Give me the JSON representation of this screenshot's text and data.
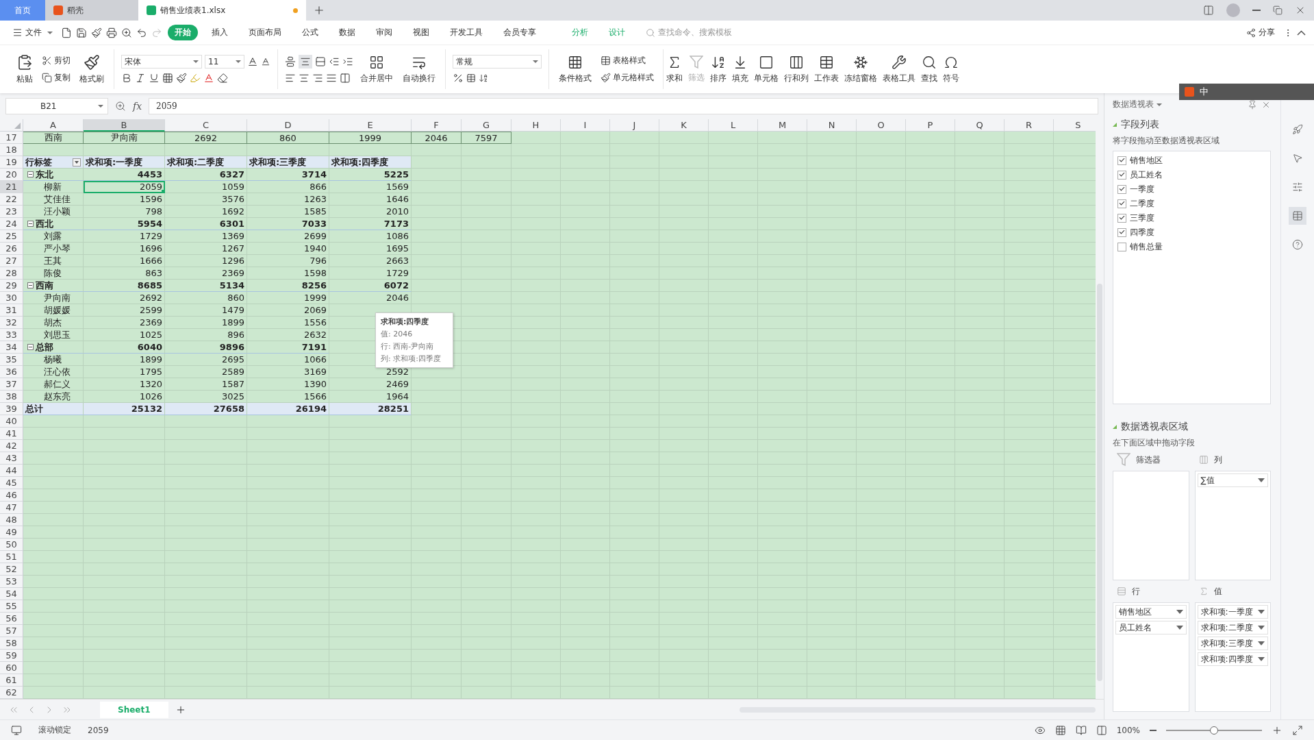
{
  "tabs": [
    {
      "label": "首页",
      "selected": false,
      "kind": "home"
    },
    {
      "label": "稻壳",
      "selected": false,
      "kind": "docer"
    },
    {
      "label": "销售业绩表1.xlsx",
      "selected": true,
      "kind": "sheet",
      "modified": true
    }
  ],
  "menu": {
    "file": "文件",
    "items": [
      {
        "label": "开始",
        "selected": true,
        "kind": "main"
      },
      {
        "label": "插入",
        "selected": false,
        "kind": "main"
      },
      {
        "label": "页面布局",
        "selected": false,
        "kind": "main"
      },
      {
        "label": "公式",
        "selected": false,
        "kind": "main"
      },
      {
        "label": "数据",
        "selected": false,
        "kind": "main"
      },
      {
        "label": "审阅",
        "selected": false,
        "kind": "main"
      },
      {
        "label": "视图",
        "selected": false,
        "kind": "main"
      },
      {
        "label": "开发工具",
        "selected": false,
        "kind": "main"
      },
      {
        "label": "会员专享",
        "selected": false,
        "kind": "main"
      },
      {
        "label": "分析",
        "selected": false,
        "kind": "context"
      },
      {
        "label": "设计",
        "selected": false,
        "kind": "context"
      }
    ],
    "search_placeholder": "查找命令、搜索模板",
    "share": "分享"
  },
  "ribbon": {
    "paste": "粘贴",
    "cut": "剪切",
    "copy": "复制",
    "format_painter": "格式刷",
    "font": "宋体",
    "font_size": "11",
    "merge": "合并居中",
    "wrap": "自动换行",
    "number_format": "常规",
    "conditional": "条件格式",
    "table_style": "表格样式",
    "cell_style": "单元格样式",
    "tools": [
      {
        "label": "求和",
        "disabled": false
      },
      {
        "label": "筛选",
        "disabled": true
      },
      {
        "label": "排序",
        "disabled": false
      },
      {
        "label": "填充",
        "disabled": false
      },
      {
        "label": "单元格",
        "disabled": false
      },
      {
        "label": "行和列",
        "disabled": false
      },
      {
        "label": "工作表",
        "disabled": false
      },
      {
        "label": "冻结窗格",
        "disabled": false
      },
      {
        "label": "表格工具",
        "disabled": false
      },
      {
        "label": "查找",
        "disabled": false
      },
      {
        "label": "符号",
        "disabled": false
      }
    ]
  },
  "ime": {
    "label": "中"
  },
  "name_box": "B21",
  "function_label": "fx",
  "formula": "2059",
  "columns": [
    {
      "label": "A",
      "selected": false
    },
    {
      "label": "B",
      "selected": true
    },
    {
      "label": "C",
      "selected": false
    },
    {
      "label": "D",
      "selected": false
    },
    {
      "label": "E",
      "selected": false
    },
    {
      "label": "F",
      "selected": false
    },
    {
      "label": "G",
      "selected": false
    },
    {
      "label": "H",
      "selected": false
    },
    {
      "label": "I",
      "selected": false
    },
    {
      "label": "J",
      "selected": false
    },
    {
      "label": "K",
      "selected": false
    },
    {
      "label": "L",
      "selected": false
    },
    {
      "label": "M",
      "selected": false
    },
    {
      "label": "N",
      "selected": false
    },
    {
      "label": "O",
      "selected": false
    },
    {
      "label": "P",
      "selected": false
    },
    {
      "label": "Q",
      "selected": false
    },
    {
      "label": "R",
      "selected": false
    },
    {
      "label": "S",
      "selected": false
    }
  ],
  "rows": [
    {
      "number": "17",
      "kind": "plain",
      "selected": false,
      "cells": [
        "西南",
        "尹向南",
        "2692",
        "860",
        "1999",
        "2046",
        "7597"
      ]
    },
    {
      "number": "18",
      "kind": "empty",
      "selected": false
    },
    {
      "number": "19",
      "kind": "pivot-header",
      "selected": false,
      "cells": [
        "行标签",
        "求和项:一季度",
        "求和项:二季度",
        "求和项:三季度",
        "求和项:四季度"
      ]
    },
    {
      "number": "20",
      "kind": "group",
      "expanded": true,
      "selected": false,
      "cells": [
        "东北",
        "4453",
        "6327",
        "3714",
        "5225"
      ]
    },
    {
      "number": "21",
      "kind": "item",
      "selected": true,
      "cells": [
        "柳新",
        "2059",
        "1059",
        "866",
        "1569"
      ]
    },
    {
      "number": "22",
      "kind": "item",
      "selected": false,
      "cells": [
        "艾佳佳",
        "1596",
        "3576",
        "1263",
        "1646"
      ]
    },
    {
      "number": "23",
      "kind": "item",
      "selected": false,
      "cells": [
        "汪小颖",
        "798",
        "1692",
        "1585",
        "2010"
      ]
    },
    {
      "number": "24",
      "kind": "group",
      "expanded": true,
      "selected": false,
      "cells": [
        "西北",
        "5954",
        "6301",
        "7033",
        "7173"
      ]
    },
    {
      "number": "25",
      "kind": "item",
      "selected": false,
      "cells": [
        "刘露",
        "1729",
        "1369",
        "2699",
        "1086"
      ]
    },
    {
      "number": "26",
      "kind": "item",
      "selected": false,
      "cells": [
        "严小琴",
        "1696",
        "1267",
        "1940",
        "1695"
      ]
    },
    {
      "number": "27",
      "kind": "item",
      "selected": false,
      "cells": [
        "王其",
        "1666",
        "1296",
        "796",
        "2663"
      ]
    },
    {
      "number": "28",
      "kind": "item",
      "selected": false,
      "cells": [
        "陈俊",
        "863",
        "2369",
        "1598",
        "1729"
      ]
    },
    {
      "number": "29",
      "kind": "group",
      "expanded": true,
      "selected": false,
      "cells": [
        "西南",
        "8685",
        "5134",
        "8256",
        "6072"
      ]
    },
    {
      "number": "30",
      "kind": "item",
      "selected": false,
      "cells": [
        "尹向南",
        "2692",
        "860",
        "1999",
        "2046"
      ]
    },
    {
      "number": "31",
      "kind": "item",
      "selected": false,
      "cells": [
        "胡媛媛",
        "2599",
        "1479",
        "2069"
      ]
    },
    {
      "number": "32",
      "kind": "item",
      "selected": false,
      "cells": [
        "胡杰",
        "2369",
        "1899",
        "1556"
      ]
    },
    {
      "number": "33",
      "kind": "item",
      "selected": false,
      "cells": [
        "刘思玉",
        "1025",
        "896",
        "2632"
      ]
    },
    {
      "number": "34",
      "kind": "group",
      "expanded": true,
      "selected": false,
      "cells": [
        "总部",
        "6040",
        "9896",
        "7191"
      ]
    },
    {
      "number": "35",
      "kind": "item",
      "selected": false,
      "cells": [
        "杨曦",
        "1899",
        "2695",
        "1066"
      ]
    },
    {
      "number": "36",
      "kind": "item",
      "selected": false,
      "cells": [
        "汪心依",
        "1795",
        "2589",
        "3169",
        "2592"
      ]
    },
    {
      "number": "37",
      "kind": "item",
      "selected": false,
      "cells": [
        "郝仁义",
        "1320",
        "1587",
        "1390",
        "2469"
      ]
    },
    {
      "number": "38",
      "kind": "item",
      "selected": false,
      "cells": [
        "赵东亮",
        "1026",
        "3025",
        "1566",
        "1964"
      ]
    },
    {
      "number": "39",
      "kind": "total",
      "selected": false,
      "cells": [
        "总计",
        "25132",
        "27658",
        "26194",
        "28251"
      ]
    },
    {
      "number": "40",
      "kind": "empty",
      "selected": false
    },
    {
      "number": "41",
      "kind": "empty",
      "selected": false
    },
    {
      "number": "42",
      "kind": "empty",
      "selected": false
    },
    {
      "number": "43",
      "kind": "empty",
      "selected": false
    },
    {
      "number": "44",
      "kind": "empty",
      "selected": false
    },
    {
      "number": "45",
      "kind": "empty",
      "selected": false
    },
    {
      "number": "46",
      "kind": "empty",
      "selected": false
    },
    {
      "number": "47",
      "kind": "empty",
      "selected": false
    },
    {
      "number": "48",
      "kind": "empty",
      "selected": false
    },
    {
      "number": "49",
      "kind": "empty",
      "selected": false
    },
    {
      "number": "50",
      "kind": "empty",
      "selected": false
    },
    {
      "number": "51",
      "kind": "empty",
      "selected": false
    },
    {
      "number": "52",
      "kind": "empty",
      "selected": false
    },
    {
      "number": "53",
      "kind": "empty",
      "selected": false
    },
    {
      "number": "54",
      "kind": "empty",
      "selected": false
    },
    {
      "number": "55",
      "kind": "empty",
      "selected": false
    },
    {
      "number": "56",
      "kind": "empty",
      "selected": false
    },
    {
      "number": "57",
      "kind": "empty",
      "selected": false
    },
    {
      "number": "58",
      "kind": "empty",
      "selected": false
    },
    {
      "number": "59",
      "kind": "empty",
      "selected": false
    },
    {
      "number": "60",
      "kind": "empty",
      "selected": false
    },
    {
      "number": "61",
      "kind": "empty",
      "selected": false
    },
    {
      "number": "62",
      "kind": "empty",
      "selected": false
    }
  ],
  "tooltip": {
    "title": "求和项:四季度",
    "lines": [
      "值: 2046",
      "行: 西南-尹向南",
      "列: 求和项:四季度"
    ]
  },
  "sheet_tabs": [
    {
      "label": "Sheet1",
      "selected": true
    }
  ],
  "panel": {
    "title": "数据透视表",
    "field_section": "字段列表",
    "field_hint": "将字段拖动至数据透视表区域",
    "fields": [
      {
        "label": "销售地区",
        "checked": true
      },
      {
        "label": "员工姓名",
        "checked": true
      },
      {
        "label": "一季度",
        "checked": true
      },
      {
        "label": "二季度",
        "checked": true
      },
      {
        "label": "三季度",
        "checked": true
      },
      {
        "label": "四季度",
        "checked": true
      },
      {
        "label": "销售总量",
        "checked": false
      }
    ],
    "area_section": "数据透视表区域",
    "area_hint": "在下面区域中拖动字段",
    "areas": [
      {
        "kind": "filter",
        "label": "筛选器"
      },
      {
        "kind": "columns",
        "label": "列",
        "items": [
          "∑值"
        ]
      },
      {
        "kind": "rows",
        "label": "行",
        "items": [
          "销售地区",
          "员工姓名"
        ]
      },
      {
        "kind": "values",
        "label": "值",
        "items": [
          "求和项:一季度",
          "求和项:二季度",
          "求和项:三季度",
          "求和项:四季度"
        ]
      }
    ]
  },
  "status": {
    "mode": "滚动锁定",
    "value": "2059",
    "zoom": "100%",
    "level": 0.5
  }
}
